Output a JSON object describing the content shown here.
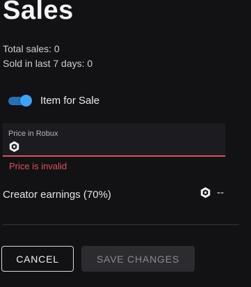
{
  "header": {
    "title": "Sales"
  },
  "stats": {
    "total_sales": "Total sales: 0",
    "sold_last_7_days": "Sold in last 7 days: 0"
  },
  "item_for_sale": {
    "label": "Item for Sale",
    "enabled": true,
    "accent_color": "#3aa2ff"
  },
  "price": {
    "label": "Price in Robux",
    "value": "",
    "currency_icon": "robux-icon",
    "error": "Price is invalid",
    "error_color": "#e0515a"
  },
  "creator_earnings": {
    "label": "Creator earnings (70%)",
    "currency_icon": "robux-icon",
    "value": "--"
  },
  "actions": {
    "cancel_label": "CANCEL",
    "save_label": "SAVE CHANGES",
    "save_enabled": false
  }
}
